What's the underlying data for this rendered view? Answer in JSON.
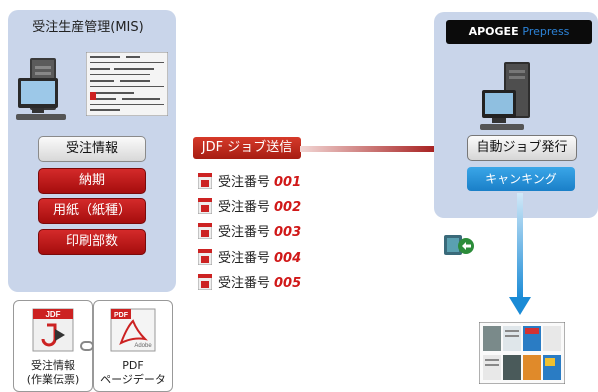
{
  "mis": {
    "title": "受注生産管理(MIS)",
    "buttons": [
      {
        "label": "受注情報",
        "style": "gray"
      },
      {
        "label": "納期",
        "style": "red"
      },
      {
        "label": "用紙（紙種）",
        "style": "red"
      },
      {
        "label": "印刷部数",
        "style": "red"
      }
    ]
  },
  "jdf_send": {
    "label": "JDF ジョブ送信"
  },
  "orders": [
    {
      "label": "受注番号",
      "number": "001"
    },
    {
      "label": "受注番号",
      "number": "002"
    },
    {
      "label": "受注番号",
      "number": "003"
    },
    {
      "label": "受注番号",
      "number": "004"
    },
    {
      "label": "受注番号",
      "number": "005"
    }
  ],
  "apogee": {
    "brand": "APOGEE",
    "brand_accent": "Prepress",
    "auto_job": "自動ジョブ発行",
    "cancel": "キャンキング"
  },
  "files": {
    "jdf": {
      "badge": "JDF",
      "line1": "受注情報",
      "line2": "(作業伝票)"
    },
    "pdf": {
      "badge": "PDF",
      "sublogo": "Adobe",
      "line1": "PDF",
      "line2": "ページデータ"
    }
  },
  "colors": {
    "red": "#b51a14",
    "panel": "#c9d5ea",
    "blue": "#1a8bd6",
    "dark": "#0b0b0b"
  }
}
